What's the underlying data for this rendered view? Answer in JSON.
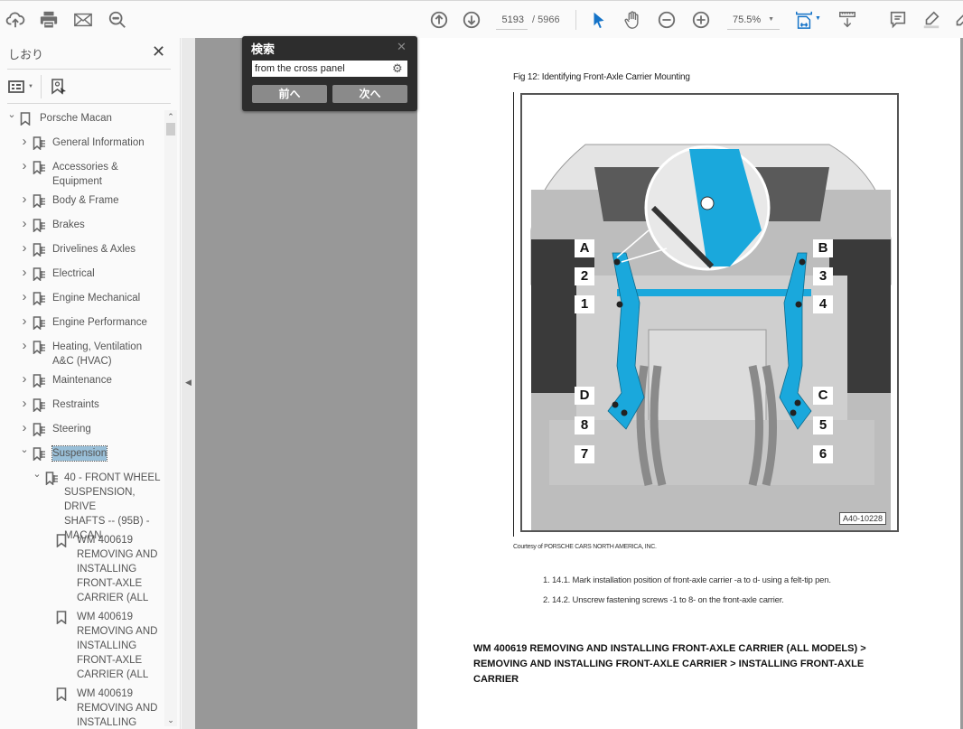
{
  "toolbar": {
    "left_icons": [
      "upload-cloud-icon",
      "print-icon",
      "mail-icon",
      "search-icon"
    ],
    "page_current": "5193",
    "page_total": "/ 5966",
    "zoom_level": "75.5%",
    "right_icons": [
      "prev-page-icon",
      "next-page-icon",
      "select-cursor-icon",
      "hand-icon",
      "zoom-out-icon",
      "zoom-in-icon",
      "fit-page-icon",
      "measure-icon",
      "comment-icon",
      "highlight-icon",
      "draw-icon"
    ]
  },
  "sidebar": {
    "title": "しおり",
    "close": "✕",
    "tree": [
      {
        "label": "Porsche Macan",
        "level": 0,
        "expanded": true,
        "icon": "bookmark"
      },
      {
        "label": "General Information",
        "level": 1,
        "expanded": false,
        "icon": "tagged-bookmark"
      },
      {
        "label": "Accessories &\nEquipment",
        "level": 1,
        "expanded": false,
        "icon": "tagged-bookmark"
      },
      {
        "label": "Body & Frame",
        "level": 1,
        "expanded": false,
        "icon": "tagged-bookmark"
      },
      {
        "label": "Brakes",
        "level": 1,
        "expanded": false,
        "icon": "tagged-bookmark"
      },
      {
        "label": "Drivelines & Axles",
        "level": 1,
        "expanded": false,
        "icon": "tagged-bookmark"
      },
      {
        "label": "Electrical",
        "level": 1,
        "expanded": false,
        "icon": "tagged-bookmark"
      },
      {
        "label": "Engine Mechanical",
        "level": 1,
        "expanded": false,
        "icon": "tagged-bookmark"
      },
      {
        "label": "Engine Performance",
        "level": 1,
        "expanded": false,
        "icon": "tagged-bookmark"
      },
      {
        "label": "Heating, Ventilation\nA&C (HVAC)",
        "level": 1,
        "expanded": false,
        "icon": "tagged-bookmark"
      },
      {
        "label": "Maintenance",
        "level": 1,
        "expanded": false,
        "icon": "tagged-bookmark"
      },
      {
        "label": "Restraints",
        "level": 1,
        "expanded": false,
        "icon": "tagged-bookmark"
      },
      {
        "label": "Steering",
        "level": 1,
        "expanded": false,
        "icon": "tagged-bookmark"
      },
      {
        "label": "Suspension",
        "level": 1,
        "expanded": true,
        "selected": true,
        "icon": "tagged-bookmark"
      },
      {
        "label": "40 - FRONT WHEEL\nSUSPENSION, DRIVE\nSHAFTS -- (95B) -\nMACAN",
        "level": 2,
        "expanded": true,
        "icon": "tagged-bookmark"
      },
      {
        "label": "WM 400619\nREMOVING AND\nINSTALLING\nFRONT-AXLE\nCARRIER (ALL",
        "level": 3,
        "icon": "bookmark"
      },
      {
        "label": "WM 400619\nREMOVING AND\nINSTALLING\nFRONT-AXLE\nCARRIER (ALL",
        "level": 3,
        "icon": "bookmark"
      },
      {
        "label": "WM 400619\nREMOVING AND\nINSTALLING",
        "level": 3,
        "icon": "bookmark"
      }
    ]
  },
  "find": {
    "title": "検索",
    "query": "from the cross panel",
    "prev_label": "前へ",
    "next_label": "次へ"
  },
  "document": {
    "figure_caption": "Fig 12: Identifying Front-Axle Carrier Mounting",
    "figure_id": "A40-10228",
    "callouts": [
      "A",
      "B",
      "1",
      "2",
      "3",
      "4",
      "5",
      "6",
      "7",
      "8",
      "C",
      "D"
    ],
    "courtesy": "Courtesy of PORSCHE CARS NORTH AMERICA, INC.",
    "steps": [
      "1. 14.1. Mark installation position of front-axle carrier -a to d- using a felt-tip pen.",
      "2. 14.2. Unscrew fastening screws -1 to 8- on the front-axle carrier."
    ],
    "section_heading": "WM 400619 REMOVING AND INSTALLING FRONT-AXLE CARRIER (ALL MODELS) > REMOVING AND INSTALLING FRONT-AXLE CARRIER > INSTALLING FRONT-AXLE CARRIER"
  },
  "colors": {
    "highlight_part": "#1aa8dc",
    "selection": "#99bfd8",
    "canvas": "#989898",
    "find_panel": "#2d2d2d"
  }
}
